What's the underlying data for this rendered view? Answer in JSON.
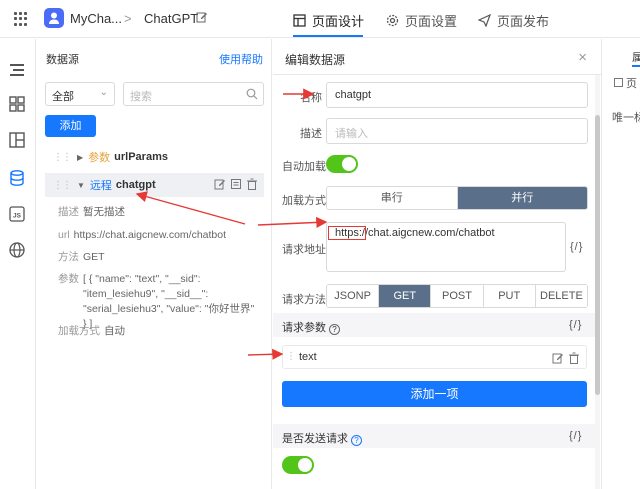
{
  "topbar": {
    "app_name": "MyCha...",
    "breadcrumb_sep": ">",
    "page_name": "ChatGPT",
    "tabs": [
      {
        "label": "页面设计",
        "icon": "layout-icon",
        "active": true
      },
      {
        "label": "页面设置",
        "icon": "gear-icon",
        "active": false
      },
      {
        "label": "页面发布",
        "icon": "send-icon",
        "active": false
      }
    ]
  },
  "leftnav": {
    "icons": [
      "outline-icon",
      "components-icon",
      "layers-icon",
      "datasource-icon",
      "js-icon",
      "globe-icon"
    ],
    "js_label": "JS"
  },
  "datasource": {
    "title": "数据源",
    "help": "使用帮助",
    "filter_value": "全部",
    "search_placeholder": "搜索",
    "add_label": "添加",
    "items": [
      {
        "type_label": "参数",
        "name": "urlParams"
      },
      {
        "type_label": "远程",
        "name": "chatgpt"
      }
    ],
    "details": {
      "desc_key": "描述",
      "desc_val": "暂无描述",
      "url_key": "url",
      "url_val": "https://chat.aigcnew.com/chatbot",
      "method_key": "方法",
      "method_val": "GET",
      "params_key": "参数",
      "params_val": "[ { \"name\": \"text\", \"__sid\": \"item_lesiehu9\", \"__sid__\": \"serial_lesiehu3\", \"value\": \"你好世界\" } ]",
      "load_key": "加载方式",
      "load_val": "自动"
    }
  },
  "editor": {
    "title": "编辑数据源",
    "close": "×",
    "name_label": "名称",
    "name_value": "chatgpt",
    "desc_label": "描述",
    "desc_placeholder": "请输入",
    "autoload_label": "自动加载",
    "autoload_on": true,
    "load_mode_label": "加载方式",
    "load_modes": [
      {
        "label": "串行",
        "on": false
      },
      {
        "label": "并行",
        "on": true
      }
    ],
    "url_label": "请求地址",
    "url_value": "https://chat.aigcnew.com/chatbot",
    "code_btn": "{/}",
    "method_label": "请求方法",
    "methods": [
      {
        "label": "JSONP",
        "on": false
      },
      {
        "label": "GET",
        "on": true
      },
      {
        "label": "POST",
        "on": false
      },
      {
        "label": "PUT",
        "on": false
      },
      {
        "label": "DELETE",
        "on": false
      }
    ],
    "params_section": "请求参数",
    "param_name": "text",
    "add_item": "添加一项",
    "send_section": "是否发送请求",
    "send_on": true
  },
  "right_panel": {
    "tab_label": "属",
    "sub_label": "页",
    "row_label": "唯一标"
  },
  "colors": {
    "accent": "#1677ff",
    "toggle_on": "#52c41a",
    "segment_on": "#5a6f8a",
    "annotation": "#e53935"
  }
}
